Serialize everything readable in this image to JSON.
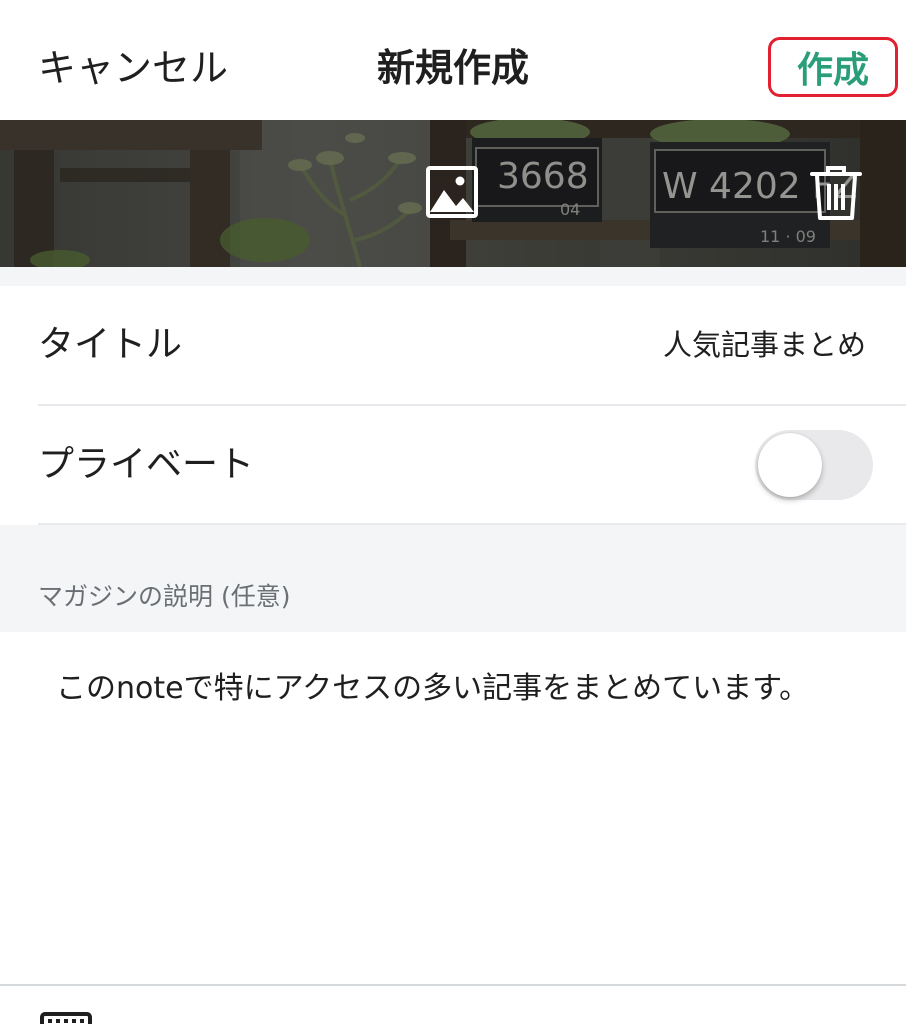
{
  "header": {
    "cancel_label": "キャンセル",
    "title": "新規作成",
    "create_label": "作成"
  },
  "cover": {
    "image_button_icon": "image-icon",
    "delete_button_icon": "trash-icon",
    "plate_left": "3668",
    "plate_left_sub": "04",
    "plate_right": "W 4202 FZ",
    "plate_right_sub": "11 · 09"
  },
  "form": {
    "title_label": "タイトル",
    "title_value": "人気記事まとめ",
    "private_label": "プライベート",
    "private_enabled": false
  },
  "description": {
    "section_label": "マガジンの説明 (任意)",
    "text": "このnoteで特にアクセスの多い記事をまとめています。"
  },
  "toolbar": {
    "keyboard_icon": "keyboard-icon"
  },
  "colors": {
    "accent_green": "#2a9d79",
    "highlight_red": "#e3202f",
    "section_bg": "#f3f5f7",
    "toggle_off": "#e9e9eb"
  }
}
